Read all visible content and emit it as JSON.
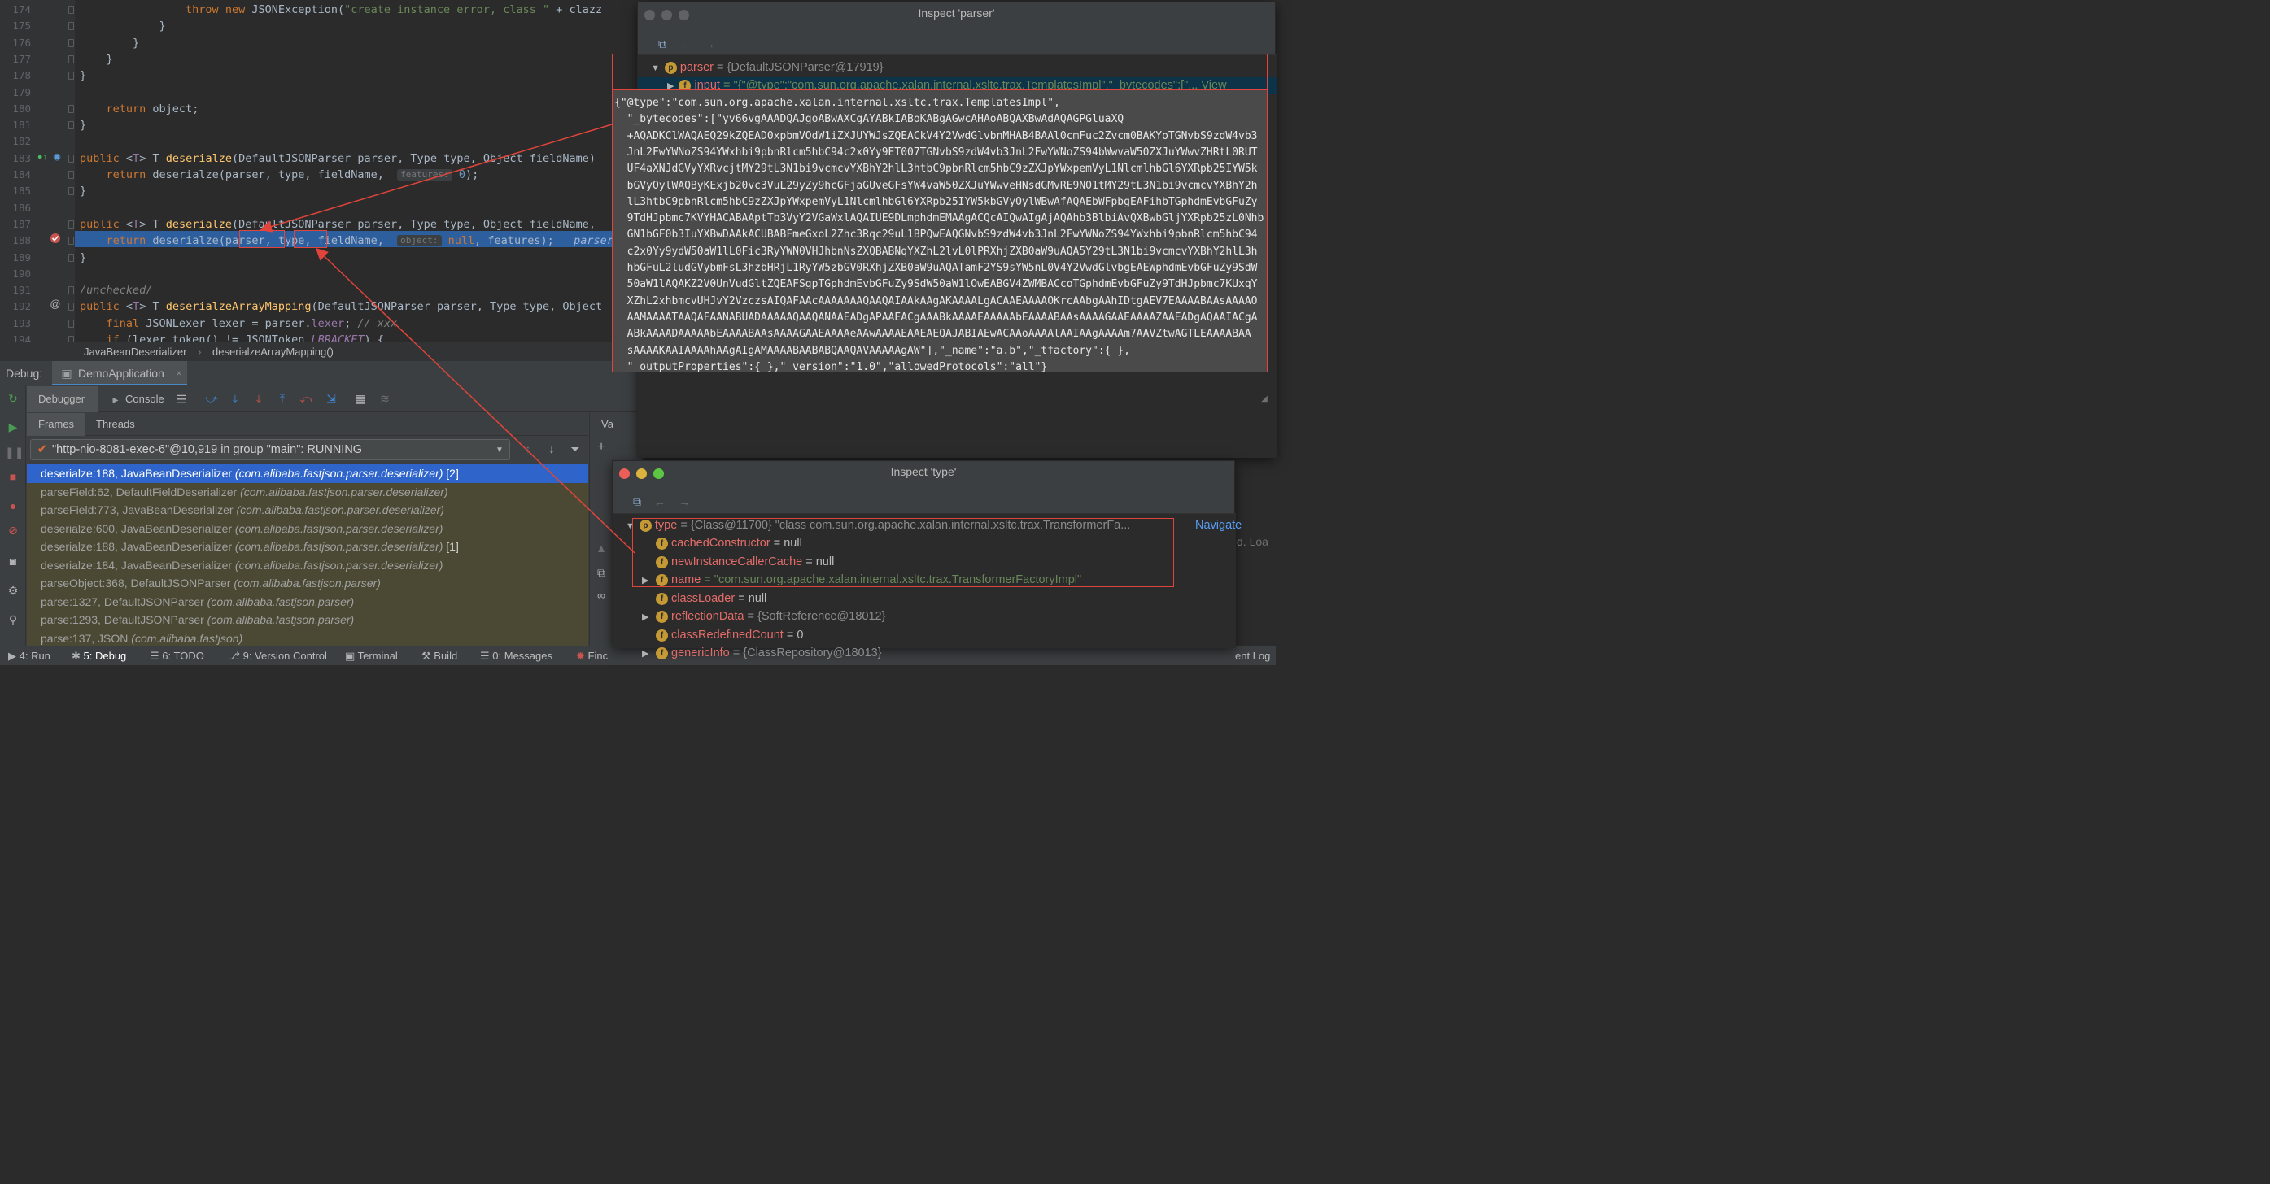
{
  "editor": {
    "lines": [
      {
        "n": "174",
        "html": "                <span class=\"kw\">throw new</span> JSONException(<span class=\"str\">\"create instance error, class \"</span> + clazz"
      },
      {
        "n": "175",
        "html": "            }"
      },
      {
        "n": "176",
        "html": "        }"
      },
      {
        "n": "177",
        "html": "    }"
      },
      {
        "n": "178",
        "html": "}"
      },
      {
        "n": "179",
        "html": ""
      },
      {
        "n": "180",
        "html": "    <span class=\"kw\">return</span> object;"
      },
      {
        "n": "181",
        "html": "}"
      },
      {
        "n": "182",
        "html": ""
      },
      {
        "n": "183",
        "html": "<span class=\"kw\">public</span> &lt;<span class=\"fld\">T</span>&gt; T <span class=\"fn\">deserialze</span>(DefaultJSONParser parser, Type type, Object fieldName)"
      },
      {
        "n": "184",
        "html": "    <span class=\"kw\">return</span> deserialze(parser, type, fieldName,  <span class=\"hint\">features:</span> <span class=\"num\">0</span>);"
      },
      {
        "n": "185",
        "html": "}"
      },
      {
        "n": "186",
        "html": ""
      },
      {
        "n": "187",
        "html": "<span class=\"kw\">public</span> &lt;<span class=\"fld\">T</span>&gt; T <span class=\"fn\">deserialze</span>(DefaultJSONParser parser, Type type, Object fieldName,"
      },
      {
        "n": "188",
        "html": "    <span class=\"kw\">return</span> deserialze(parser, type, fieldName,  <span class=\"hint\">object:</span> <span class=\"kw\">null</span>, features);   <span style=\"color:#9fb6d8;font-style:italic\">parser:</span>"
      },
      {
        "n": "189",
        "html": "}"
      },
      {
        "n": "190",
        "html": ""
      },
      {
        "n": "191",
        "html": "<span class=\"cm\">/unchecked/</span>"
      },
      {
        "n": "192",
        "html": "<span class=\"kw\">public</span> &lt;<span class=\"fld\">T</span>&gt; T <span class=\"fn\">deserialzeArrayMapping</span>(DefaultJSONParser parser, Type type, Object"
      },
      {
        "n": "193",
        "html": "    <span class=\"kw\">final</span> JSONLexer lexer = parser.<span class=\"fld\">lexer</span>; <span class=\"cm\">// xxx</span>"
      },
      {
        "n": "194",
        "html": "    <span class=\"kw\">if</span> (lexer.token() != JSONToken.<span class=\"fld\"><i>LBRACKET</i></span>) {"
      }
    ]
  },
  "breadcrumb": {
    "class": "JavaBeanDeserializer",
    "sep": "›",
    "method": "deserialzeArrayMapping()"
  },
  "debug": {
    "label": "Debug:",
    "config": "DemoApplication",
    "tab_debugger": "Debugger",
    "tab_console": "Console",
    "tab_frames": "Frames",
    "tab_threads": "Threads",
    "thread": "\"http-nio-8081-exec-6\"@10,919 in group \"main\": RUNNING",
    "side_label": "Va",
    "frames": [
      {
        "m": "deserialze:188, JavaBeanDeserializer",
        "p": "(com.alibaba.fastjson.parser.deserializer)",
        "s": "[2]",
        "sel": true
      },
      {
        "m": "parseField:62, DefaultFieldDeserializer",
        "p": "(com.alibaba.fastjson.parser.deserializer)",
        "s": ""
      },
      {
        "m": "parseField:773, JavaBeanDeserializer",
        "p": "(com.alibaba.fastjson.parser.deserializer)",
        "s": ""
      },
      {
        "m": "deserialze:600, JavaBeanDeserializer",
        "p": "(com.alibaba.fastjson.parser.deserializer)",
        "s": ""
      },
      {
        "m": "deserialze:188, JavaBeanDeserializer",
        "p": "(com.alibaba.fastjson.parser.deserializer)",
        "s": "[1]"
      },
      {
        "m": "deserialze:184, JavaBeanDeserializer",
        "p": "(com.alibaba.fastjson.parser.deserializer)",
        "s": ""
      },
      {
        "m": "parseObject:368, DefaultJSONParser",
        "p": "(com.alibaba.fastjson.parser)",
        "s": ""
      },
      {
        "m": "parse:1327, DefaultJSONParser",
        "p": "(com.alibaba.fastjson.parser)",
        "s": ""
      },
      {
        "m": "parse:1293, DefaultJSONParser",
        "p": "(com.alibaba.fastjson.parser)",
        "s": ""
      },
      {
        "m": "parse:137, JSON",
        "p": "(com.alibaba.fastjson)",
        "s": ""
      }
    ]
  },
  "inspect_parser": {
    "title": "Inspect 'parser'",
    "root_name": "parser",
    "root_val": "= {DefaultJSONParser@17919}",
    "child_name": "input",
    "child_val": "= \"{\"@type\":\"com.sun.org.apache.xalan.internal.xsltc.trax.TemplatesImpl\",\"_bytecodes\":[\"... View",
    "popup_lines": [
      "{\"@type\":\"com.sun.org.apache.xalan.internal.xsltc.trax.TemplatesImpl\",",
      "  \"_bytecodes\":[\"yv66vgAAADQAJgoABwAXCgAYABkIABoKABgAGwcAHAoABQAXBwAdAQAGPGluaXQ",
      "  +AQADKClWAQAEQ29kZQEAD0xpbmVOdW1iZXJUYWJsZQEACkV4Y2VwdGlvbnMHAB4BAAl0cmFuc2Zvcm0BAKYoTGNvbS9zdW4vb3",
      "  JnL2FwYWNoZS94YWxhbi9pbnRlcm5hbC94c2x0Yy9ET007TGNvbS9zdW4vb3JnL2FwYWNoZS94bWwvaW50ZXJuYWwvZHRtL0RUT",
      "  UF4aXNJdGVyYXRvcjtMY29tL3N1bi9vcmcvYXBhY2hlL3htbC9pbnRlcm5hbC9zZXJpYWxpemVyL1NlcmlhbGl6YXRpb25IYW5k",
      "  bGVyOylWAQByKExjb20vc3VuL29yZy9hcGFjaGUveGFsYW4vaW50ZXJuYWwveHNsdGMvRE9NO1tMY29tL3N1bi9vcmcvYXBhY2h",
      "  lL3htbC9pbnRlcm5hbC9zZXJpYWxpemVyL1NlcmlhbGl6YXRpb25IYW5kbGVyOylWBwAfAQAEbWFpbgEAFihbTGphdmEvbGFuZy",
      "  9TdHJpbmc7KVYHACABAAptTb3VyY2VGaWxlAQAIUE9DLmphdmEMAAgACQcAIQwAIgAjAQAhb3BlbiAvQXBwbGljYXRpb25zL0Nhb",
      "  GN1bGF0b3IuYXBwDAAkACUBABFmeGxoL2Zhc3Rqc29uL1BPQwEAQGNvbS9zdW4vb3JnL2FwYWNoZS94YWxhbi9pbnRlcm5hbC94",
      "  c2x0Yy9ydW50aW1lL0Fic3RyYWN0VHJhbnNsZXQBABNqYXZhL2lvL0lPRXhjZXB0aW9uAQA5Y29tL3N1bi9vcmcvYXBhY2hlL3h",
      "  hbGFuL2ludGVybmFsL3hzbHRjL1RyYW5zbGV0RXhjZXB0aW9uAQATamF2YS9sYW5nL0V4Y2VwdGlvbgEAEWphdmEvbGFuZy9SdW",
      "  50aW1lAQAKZ2V0UnVudGltZQEAFSgpTGphdmEvbGFuZy9SdW50aW1lOwEABGV4ZWMBACcoTGphdmEvbGFuZy9TdHJpbmc7KUxqY",
      "  XZhL2xhbmcvUHJvY2VzczsAIQAFAAcAAAAAAAQAAQAIAAkAAgAKAAAALgACAAEAAAAOKrcAAbgAAhIDtgAEV7EAAAABAAsAAAAO",
      "  AAMAAAATAAQAFAANABUADAAAAAQAAQANAAEADgAPAAEACgAAABkAAAAEAAAAAbEAAAABAAsAAAAGAAEAAAAZAAEADgAQAAIACgA",
      "  ABkAAAADAAAAAbEAAAABAAsAAAAGAAEAAAAeAAwAAAAEAAEAEQAJABIAEwACAAoAAAAlAAIAAgAAAAm7AAVZtwAGTLEAAAABAA",
      "  sAAAAKAAIAAAAhAAgAIgAMAAAABAABABQAAQAVAAAAAgAW\"],\"_name\":\"a.b\",\"_tfactory\":{ },",
      "  \"_outputProperties\":{ },\"_version\":\"1.0\",\"allowedProtocols\":\"all\"}"
    ]
  },
  "inspect_type": {
    "title": "Inspect 'type'",
    "root_name": "type",
    "root_val": "= {Class@11700} \"class com.sun.org.apache.xalan.internal.xsltc.trax.TransformerFa...",
    "navigate": "Navigate",
    "fields": [
      {
        "name": "cachedConstructor",
        "val": "= null",
        "expand": false,
        "str": false
      },
      {
        "name": "newInstanceCallerCache",
        "val": "= null",
        "expand": false,
        "str": false
      },
      {
        "name": "name",
        "val": "= \"com.sun.org.apache.xalan.internal.xsltc.trax.TransformerFactoryImpl\"",
        "expand": true,
        "str": true
      },
      {
        "name": "classLoader",
        "val": "= null",
        "expand": false,
        "str": false
      },
      {
        "name": "reflectionData",
        "val": "= {SoftReference@18012}",
        "expand": true,
        "str": false,
        "grey": true
      },
      {
        "name": "classRedefinedCount",
        "val": "= 0",
        "expand": false,
        "str": false
      },
      {
        "name": "genericInfo",
        "val": "= {ClassRepository@18013}",
        "expand": true,
        "str": false,
        "grey": true
      }
    ],
    "right_peek": "d. Loa"
  },
  "statusbar": {
    "items": [
      {
        "label": "4: Run",
        "icon": "▶"
      },
      {
        "label": "5: Debug",
        "icon": "✱"
      },
      {
        "label": "6: TODO",
        "icon": "☰"
      },
      {
        "label": "9: Version Control",
        "icon": "⎇"
      },
      {
        "label": "Terminal",
        "icon": "▣"
      },
      {
        "label": "Build",
        "icon": "⚒"
      },
      {
        "label": "0: Messages",
        "icon": "☰"
      },
      {
        "label": "Finc",
        "icon": "✹"
      }
    ],
    "right": "ent Log"
  },
  "colors": {
    "accent": "#2f65ca",
    "highlight": "#2d5e9e",
    "annotation": "#e0443a"
  }
}
